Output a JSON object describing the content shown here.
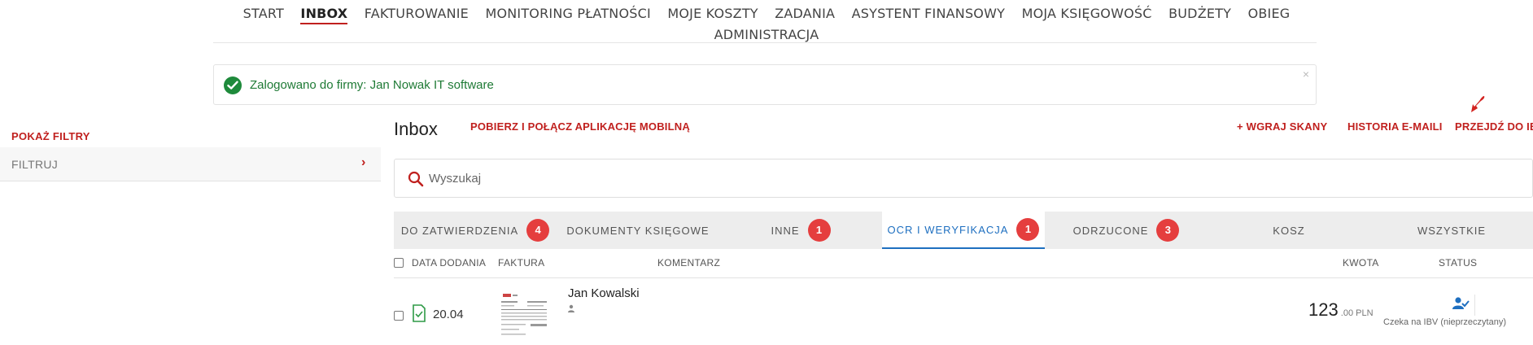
{
  "nav": {
    "items": [
      {
        "label": "START",
        "active": false
      },
      {
        "label": "INBOX",
        "active": true
      },
      {
        "label": "FAKTUROWANIE",
        "active": false
      },
      {
        "label": "MONITORING PŁATNOŚCI",
        "active": false
      },
      {
        "label": "MOJE KOSZTY",
        "active": false
      },
      {
        "label": "ZADANIA",
        "active": false
      },
      {
        "label": "ASYSTENT FINANSOWY",
        "active": false
      },
      {
        "label": "MOJA KSIĘGOWOŚĆ",
        "active": false
      },
      {
        "label": "BUDŻETY",
        "active": false
      },
      {
        "label": "OBIEG",
        "active": false
      },
      {
        "label": "ADMINISTRACJA",
        "active": false
      }
    ]
  },
  "alert": {
    "message": "Zalogowano do firmy: Jan Nowak IT software",
    "close": "×"
  },
  "filters": {
    "toggle_label": "POKAŻ FILTRY",
    "box_label": "FILTRUJ",
    "chevron": "›"
  },
  "inbox": {
    "title": "Inbox",
    "mobile_link": "POBIERZ I POŁĄCZ APLIKACJĘ MOBILNĄ",
    "upload_link": "+ WGRAJ SKANY",
    "email_history_link": "HISTORIA E-MAILI",
    "ibv_link": "PRZEJDŹ DO IBV"
  },
  "search": {
    "placeholder": "Wyszukaj"
  },
  "tabs": [
    {
      "label": "DO ZATWIERDZENIA",
      "badge": "4",
      "active": false
    },
    {
      "label": "DOKUMENTY KSIĘGOWE",
      "badge": null,
      "active": false
    },
    {
      "label": "INNE",
      "badge": "1",
      "active": false
    },
    {
      "label": "OCR I WERYFIKACJA",
      "badge": "1",
      "active": true
    },
    {
      "label": "ODRZUCONE",
      "badge": "3",
      "active": false
    },
    {
      "label": "KOSZ",
      "badge": null,
      "active": false
    },
    {
      "label": "WSZYSTKIE",
      "badge": null,
      "active": false
    }
  ],
  "table": {
    "columns": {
      "date": "DATA DODANIA",
      "invoice": "FAKTURA",
      "comment": "KOMENTARZ",
      "amount": "KWOTA",
      "status": "STATUS"
    },
    "rows": [
      {
        "date": "20.04",
        "name": "Jan Kowalski",
        "amount_main": "123",
        "amount_suffix": " .00 PLN",
        "status": "Czeka na IBV (nieprzeczytany)"
      }
    ]
  },
  "colors": {
    "accent_red": "#c0201e",
    "badge_red": "#e53e3e",
    "active_blue": "#1e6fc0",
    "success_green": "#1e8a3b"
  },
  "icons": {
    "alert": "check-circle-icon",
    "search": "search-icon",
    "document": "document-check-icon",
    "user": "user-icon",
    "status": "user-check-icon",
    "arrow": "pointer-arrow-icon"
  }
}
